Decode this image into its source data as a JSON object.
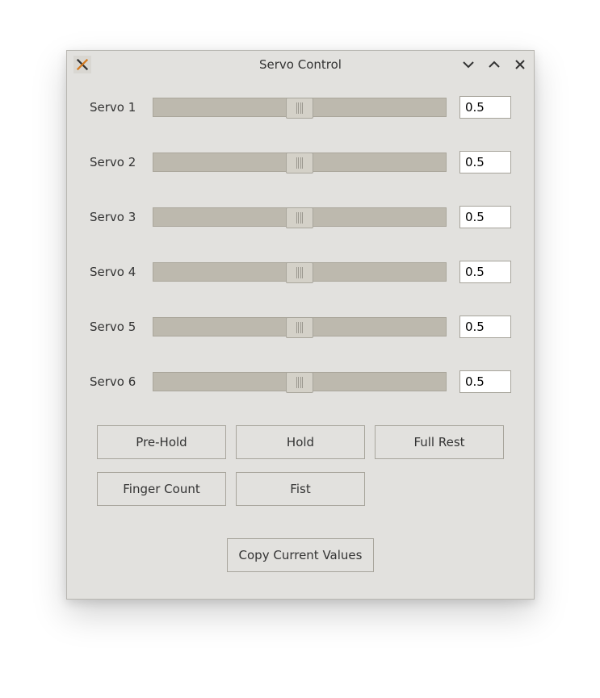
{
  "window": {
    "title": "Servo Control"
  },
  "servos": [
    {
      "label": "Servo 1",
      "value": "0.5",
      "position": 0.5
    },
    {
      "label": "Servo 2",
      "value": "0.5",
      "position": 0.5
    },
    {
      "label": "Servo 3",
      "value": "0.5",
      "position": 0.5
    },
    {
      "label": "Servo 4",
      "value": "0.5",
      "position": 0.5
    },
    {
      "label": "Servo 5",
      "value": "0.5",
      "position": 0.5
    },
    {
      "label": "Servo 6",
      "value": "0.5",
      "position": 0.5
    }
  ],
  "buttons": {
    "prehold": "Pre-Hold",
    "hold": "Hold",
    "fullrest": "Full Rest",
    "fingercount": "Finger Count",
    "fist": "Fist",
    "copy": "Copy Current Values"
  }
}
